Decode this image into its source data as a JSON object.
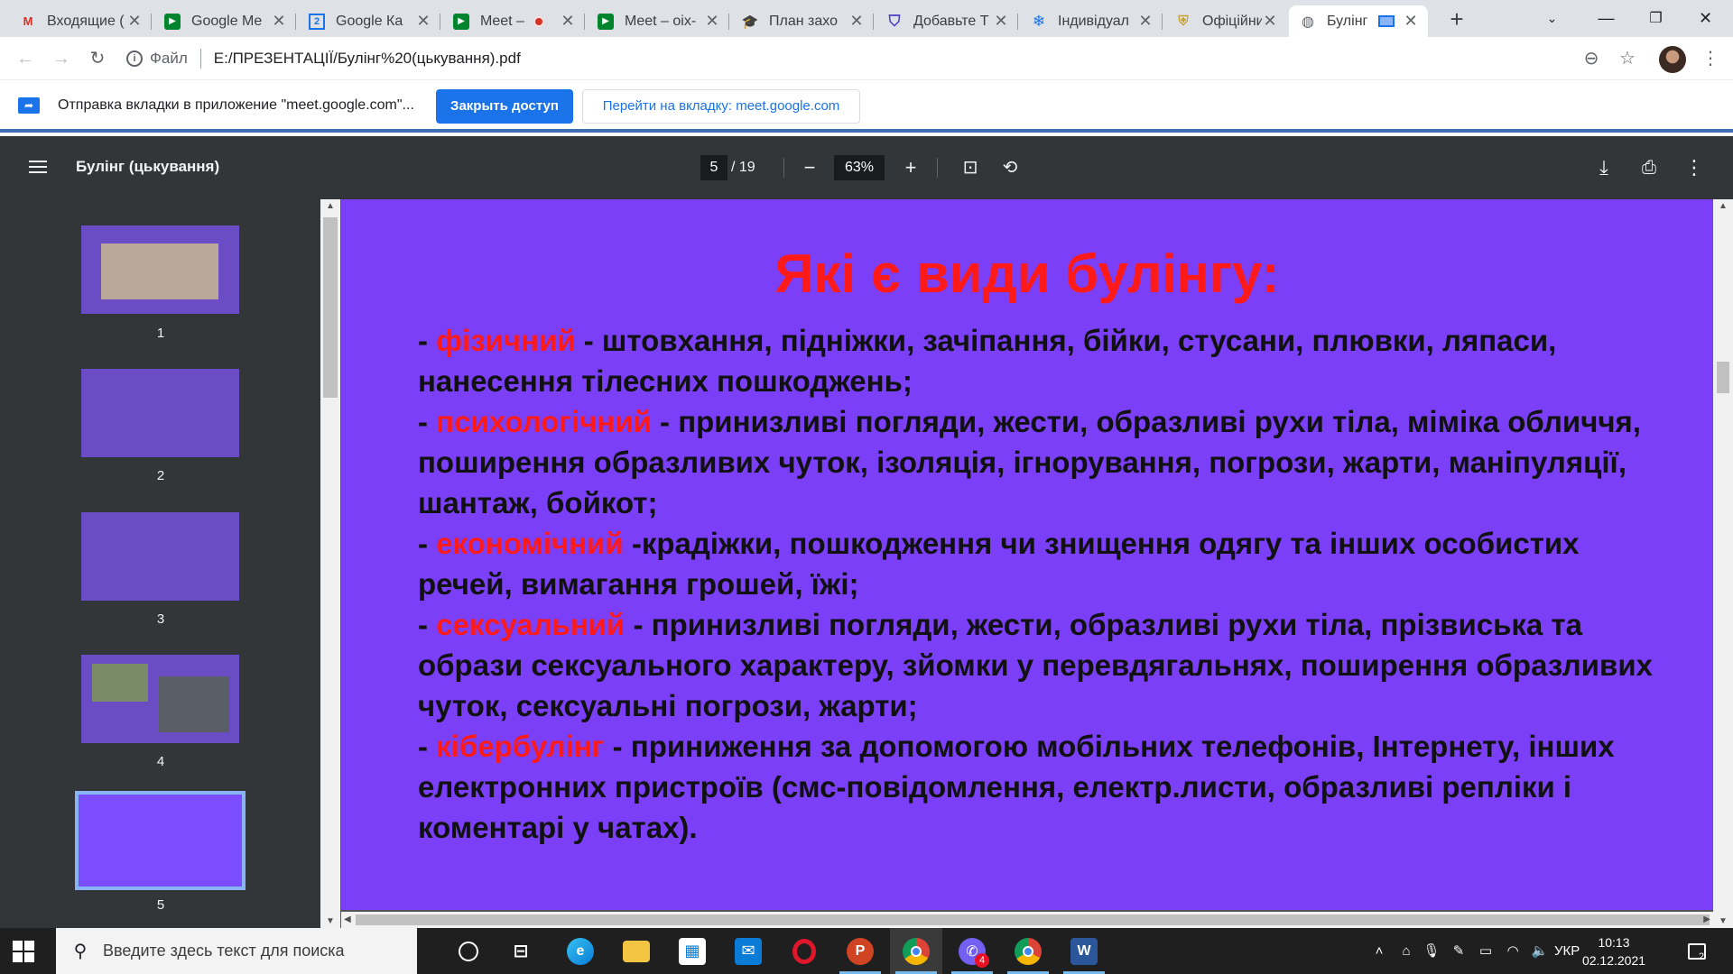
{
  "tabs": [
    {
      "title": "Входящие (",
      "icon": "gmail-icon",
      "active": false
    },
    {
      "title": "Google Me",
      "icon": "google-meet-icon",
      "active": false
    },
    {
      "title": "Google Ка",
      "icon": "google-calendar-icon",
      "active": false
    },
    {
      "title": "Meet –",
      "icon": "google-meet-icon",
      "active": false
    },
    {
      "title": "Meet – oix-",
      "icon": "google-meet-icon",
      "active": false
    },
    {
      "title": "План захо",
      "icon": "graduation-cap-icon",
      "active": false
    },
    {
      "title": "Добавьте Т",
      "icon": "shield-icon",
      "active": false
    },
    {
      "title": "Індивідуал",
      "icon": "snowflake-icon",
      "active": false
    },
    {
      "title": "Офіційний",
      "icon": "coat-of-arms-icon",
      "active": false
    },
    {
      "title": "Булінг",
      "icon": "globe-icon",
      "active": true
    }
  ],
  "address": {
    "scheme_label": "Файл",
    "url": "E:/ПРЕЗЕНТАЦІЇ/Булінг%20(цькування).pdf"
  },
  "infobar": {
    "message": "Отправка вкладки в приложение \"meet.google.com\"...",
    "stop_button": "Закрыть доступ",
    "switch_button": "Перейти на вкладку: meet.google.com"
  },
  "pdf": {
    "title": "Булінг (цькування)",
    "current_page": "5",
    "total_pages": "/ 19",
    "zoom": "63%"
  },
  "thumbnails": [
    "1",
    "2",
    "3",
    "4",
    "5"
  ],
  "selected_thumbnail": "5",
  "slide": {
    "title": "Які є види булінгу:",
    "items": [
      {
        "dash": "- ",
        "keyword": "фізичний",
        "text": " - штовхання, підніжки, зачіпання, бійки, стусани, плювки, ляпаси, нанесення тілесних пошкоджень;"
      },
      {
        "dash": "- ",
        "keyword": "психологічний",
        "text": " - принизливі погляди, жести, образливі рухи тіла, міміка обличчя, поширення образливих чуток, ізоляція, ігнорування, погрози, жарти, маніпуляції, шантаж, бойкот;"
      },
      {
        "dash": "- ",
        "keyword": "економічний",
        "text": " -крадіжки, пошкодження чи знищення одягу та інших особистих речей, вимагання грошей, їжі;"
      },
      {
        "dash": "- ",
        "keyword": "сексуальний",
        "text": " - принизливі погляди, жести, образливі рухи тіла, прізвиська та образи сексуального характеру, зйомки у перевдягальнях, поширення образливих чуток, сексуальні погрози, жарти;"
      },
      {
        "dash": "- ",
        "keyword": "кібербулінг",
        "text": " - приниження за допомогою мобільних телефонів, Інтернету, інших електронних пристроїв (смс-повідомлення, електр.листи, образливі репліки і коментарі у чатах)."
      }
    ]
  },
  "taskbar": {
    "search_placeholder": "Введите здесь текст для поиска",
    "apps": [
      "task-view-icon",
      "edge-icon",
      "file-explorer-icon",
      "store-icon",
      "mail-icon",
      "opera-icon",
      "powerpoint-icon",
      "chrome-icon",
      "viber-icon",
      "chrome-icon",
      "word-icon"
    ],
    "viber_badge": "4",
    "language": "УКР",
    "time": "10:13",
    "date": "02.12.2021",
    "notification_count": "2"
  },
  "colors": {
    "slide_background": "#7b3ff8",
    "slide_accent": "#ff1a1a",
    "pdf_toolbar": "#323639",
    "chrome_blue": "#1a73e8"
  }
}
